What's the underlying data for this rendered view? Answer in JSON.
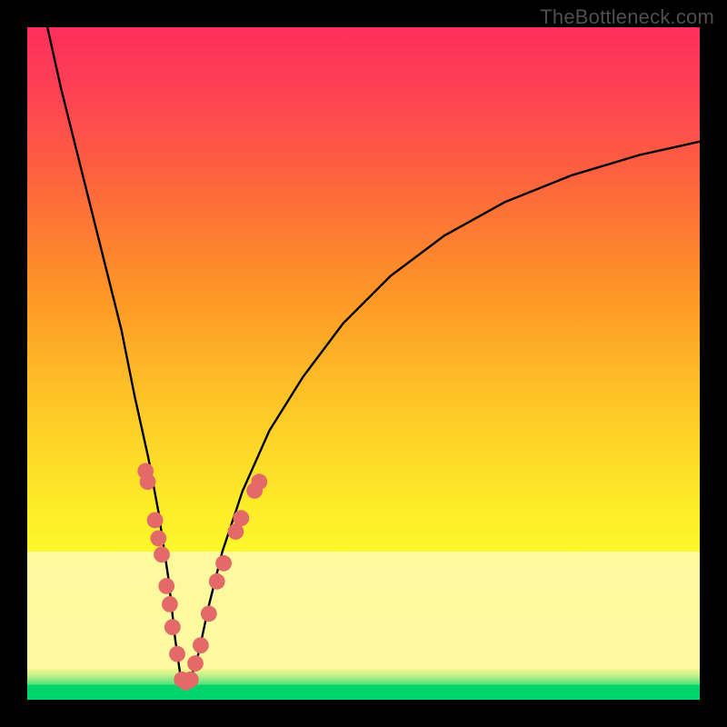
{
  "watermark": "TheBottleneck.com",
  "colors": {
    "frame": "#000000",
    "gradient_top": "#fd2f5d",
    "gradient_mid": "#fdb527",
    "gradient_band": "#fdf99d",
    "gradient_bottom": "#00d46a",
    "curve": "#000000",
    "dot": "#e46a6a"
  },
  "chart_data": {
    "type": "line",
    "title": "",
    "xlabel": "",
    "ylabel": "",
    "xlim": [
      0,
      100
    ],
    "ylim": [
      0,
      100
    ],
    "note": "Axes unlabeled; values inferred from pixel geometry on a 0-100 scale. Curve is a V-like bottleneck shape with minimum near x≈23, y≈2. Dots cluster on both arms of the V in the lower ~30% of the plot.",
    "series": [
      {
        "name": "bottleneck-curve",
        "x": [
          3,
          5,
          8,
          11,
          14,
          16,
          18,
          19.5,
          21,
          22,
          23,
          24,
          25.5,
          27,
          29,
          32,
          36,
          41,
          47,
          54,
          62,
          71,
          81,
          91,
          100
        ],
        "y": [
          100,
          91,
          79,
          67,
          55,
          45,
          36,
          28,
          18,
          9,
          2,
          2,
          7,
          14,
          22,
          31,
          40,
          48,
          56,
          63,
          69,
          74,
          78,
          81,
          83
        ]
      }
    ],
    "points": [
      {
        "name": "left-arm-dot",
        "x": 17.6,
        "y": 34.0
      },
      {
        "name": "left-arm-dot",
        "x": 17.9,
        "y": 32.4
      },
      {
        "name": "left-arm-dot",
        "x": 19.0,
        "y": 26.7
      },
      {
        "name": "left-arm-dot",
        "x": 19.5,
        "y": 24.0
      },
      {
        "name": "left-arm-dot",
        "x": 20.0,
        "y": 21.6
      },
      {
        "name": "left-arm-dot",
        "x": 20.7,
        "y": 16.9
      },
      {
        "name": "left-arm-dot",
        "x": 21.2,
        "y": 14.2
      },
      {
        "name": "left-arm-dot",
        "x": 21.6,
        "y": 10.8
      },
      {
        "name": "left-arm-dot",
        "x": 22.3,
        "y": 6.8
      },
      {
        "name": "valley-dot",
        "x": 23.0,
        "y": 3.0
      },
      {
        "name": "valley-dot",
        "x": 23.6,
        "y": 2.6
      },
      {
        "name": "valley-dot",
        "x": 24.3,
        "y": 3.0
      },
      {
        "name": "right-arm-dot",
        "x": 25.0,
        "y": 5.4
      },
      {
        "name": "right-arm-dot",
        "x": 25.8,
        "y": 8.1
      },
      {
        "name": "right-arm-dot",
        "x": 27.0,
        "y": 12.8
      },
      {
        "name": "right-arm-dot",
        "x": 28.2,
        "y": 17.6
      },
      {
        "name": "right-arm-dot",
        "x": 29.2,
        "y": 20.3
      },
      {
        "name": "right-arm-dot",
        "x": 31.0,
        "y": 25.0
      },
      {
        "name": "right-arm-dot",
        "x": 31.8,
        "y": 27.0
      },
      {
        "name": "right-arm-dot",
        "x": 33.8,
        "y": 31.1
      },
      {
        "name": "right-arm-dot",
        "x": 34.5,
        "y": 32.4
      }
    ],
    "dot_radius": 1.2
  }
}
